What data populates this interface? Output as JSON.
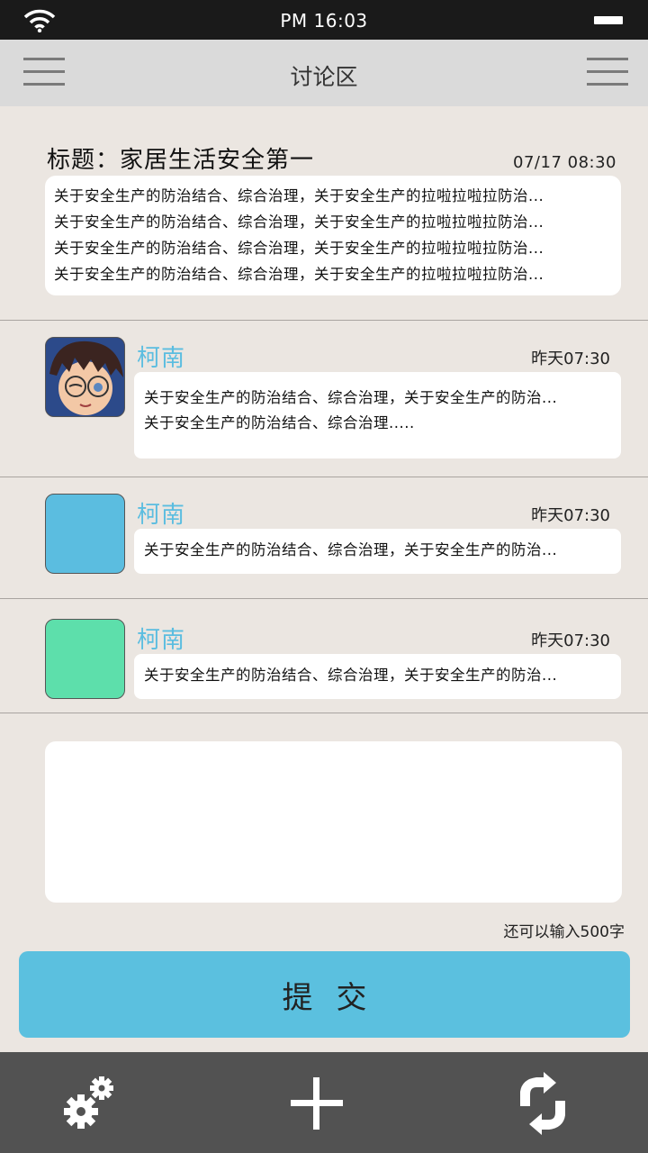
{
  "status_bar": {
    "time": "PM 16:03"
  },
  "header": {
    "title": "讨论区"
  },
  "post": {
    "title": "标题：家居生活安全第一",
    "date": "07/17 08:30",
    "lines": [
      "关于安全生产的防治结合、综合治理，关于安全生产的拉啦拉啦拉防治...",
      "关于安全生产的防治结合、综合治理，关于安全生产的拉啦拉啦拉防治...",
      "关于安全生产的防治结合、综合治理，关于安全生产的拉啦拉啦拉防治...",
      "关于安全生产的防治结合、综合治理，关于安全生产的拉啦拉啦拉防治..."
    ]
  },
  "comments": [
    {
      "author": "柯南",
      "time": "昨天07:30",
      "avatar": "cartoon-avatar",
      "lines": [
        "关于安全生产的防治结合、综合治理，关于安全生产的防治...",
        "关于安全生产的防治结合、综合治理....."
      ]
    },
    {
      "author": "柯南",
      "time": "昨天07:30",
      "avatar_color": "#5bbde0",
      "lines": [
        "关于安全生产的防治结合、综合治理，关于安全生产的防治..."
      ]
    },
    {
      "author": "柯南",
      "time": "昨天07:30",
      "avatar_color": "#5ddfab",
      "lines": [
        "关于安全生产的防治结合、综合治理，关于安全生产的防治..."
      ]
    }
  ],
  "reply": {
    "value": "",
    "char_count": "还可以输入500字"
  },
  "submit_label": "提交",
  "bottom_bar": {
    "icons": [
      "gears-icon",
      "plus-icon",
      "refresh-icon"
    ]
  },
  "colors": {
    "accent": "#5bc0df",
    "name": "#5bbde0",
    "background": "#ebe6e1",
    "header": "#dadada",
    "bottom_bar": "#525252"
  }
}
